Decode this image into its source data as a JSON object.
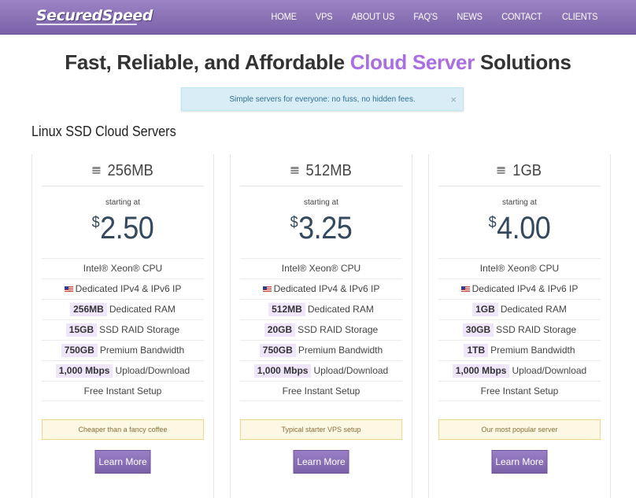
{
  "brand": {
    "logo": "SecuredSpeed"
  },
  "nav": {
    "items": [
      "HOME",
      "VPS",
      "ABOUT US",
      "FAQ'S",
      "NEWS",
      "CONTACT",
      "CLIENTS"
    ]
  },
  "headline": {
    "part1": "Fast, Reliable, and Affordable ",
    "highlight": "Cloud Server",
    "part2": " Solutions"
  },
  "alert": {
    "text": "Simple servers for everyone: no fuss, no hidden fees.",
    "close": "×"
  },
  "section": {
    "title": "Linux SSD Cloud Servers"
  },
  "plans": [
    {
      "name": "256MB",
      "starting": "starting at",
      "currency": "$",
      "price": "2.50",
      "cpu": "Intel® Xeon® CPU",
      "ip": "Dedicated IPv4 & IPv6 IP",
      "ram_val": "256MB",
      "ram_label": "Dedicated RAM",
      "storage_val": "15GB",
      "storage_label": "SSD RAID Storage",
      "bw_val": "750GB",
      "bw_label": "Premium Bandwidth",
      "speed_val": "1,000 Mbps",
      "speed_label": "Upload/Download",
      "setup": "Free Instant Setup",
      "note": "Cheaper than a fancy coffee",
      "button": "Learn More"
    },
    {
      "name": "512MB",
      "starting": "starting at",
      "currency": "$",
      "price": "3.25",
      "cpu": "Intel® Xeon® CPU",
      "ip": "Dedicated IPv4 & IPv6 IP",
      "ram_val": "512MB",
      "ram_label": "Dedicated RAM",
      "storage_val": "20GB",
      "storage_label": "SSD RAID Storage",
      "bw_val": "750GB",
      "bw_label": "Premium Bandwidth",
      "speed_val": "1,000 Mbps",
      "speed_label": "Upload/Download",
      "setup": "Free Instant Setup",
      "note": "Typical starter VPS setup",
      "button": "Learn More"
    },
    {
      "name": "1GB",
      "starting": "starting at",
      "currency": "$",
      "price": "4.00",
      "cpu": "Intel® Xeon® CPU",
      "ip": "Dedicated IPv4 & IPv6 IP",
      "ram_val": "1GB",
      "ram_label": "Dedicated RAM",
      "storage_val": "30GB",
      "storage_label": "SSD RAID Storage",
      "bw_val": "1TB",
      "bw_label": "Premium Bandwidth",
      "speed_val": "1,000 Mbps",
      "speed_label": "Upload/Download",
      "setup": "Free Instant Setup",
      "note": "Our most popular server",
      "button": "Learn More"
    }
  ],
  "colors": {
    "nav": "#8a70b8",
    "accent": "#a96ee2",
    "price": "#34495e",
    "alert_bg": "#d9edf7",
    "note_bg": "#fcf8e3"
  },
  "icons": {
    "server": "server-icon",
    "flag": "us-flag-icon",
    "close": "close-icon"
  }
}
